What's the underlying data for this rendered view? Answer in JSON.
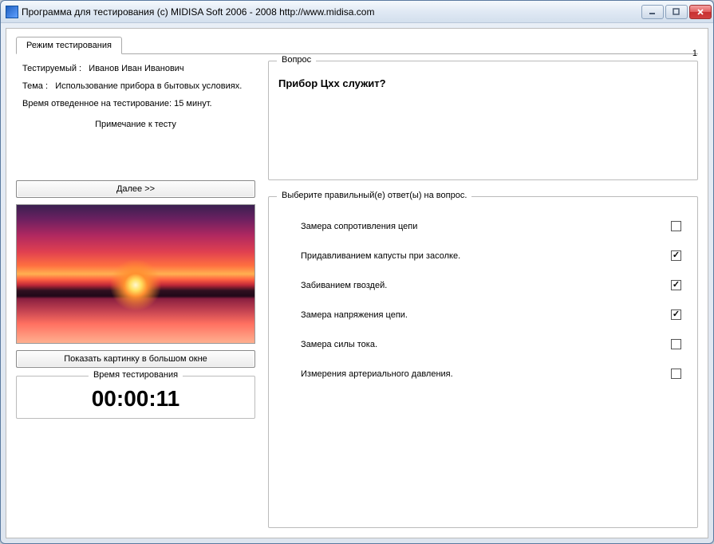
{
  "window": {
    "title": "Программа для тестирования (c) MIDISA Soft 2006 - 2008 http://www.midisa.com"
  },
  "tab": {
    "label": "Режим тестирования"
  },
  "info": {
    "testee_label": "Тестируемый :",
    "testee_value": "Иванов Иван Иванович",
    "topic_label": "Тема :",
    "topic_value": "Использование прибора в бытовых условиях.",
    "time_label": "Время отведенное на тестирование: 15 минут.",
    "note_label": "Примечание к тесту"
  },
  "buttons": {
    "next": "Далее >>",
    "show_image": "Показать картинку в большом окне"
  },
  "timer": {
    "group_label": "Время тестирования",
    "value": "00:00:11"
  },
  "question": {
    "group_label": "Вопрос",
    "number": "1",
    "text": "Прибор Цхх служит?"
  },
  "answers": {
    "group_label": "Выберите правильный(е) ответ(ы) на вопрос.",
    "items": [
      {
        "text": "Замера сопротивления цепи",
        "checked": false
      },
      {
        "text": "Придавливанием капусты при засолке.",
        "checked": true
      },
      {
        "text": "Забиванием гвоздей.",
        "checked": true
      },
      {
        "text": "Замера напряжения цепи.",
        "checked": true
      },
      {
        "text": "Замера силы тока.",
        "checked": false
      },
      {
        "text": "Измерения артериального давления.",
        "checked": false
      }
    ]
  }
}
